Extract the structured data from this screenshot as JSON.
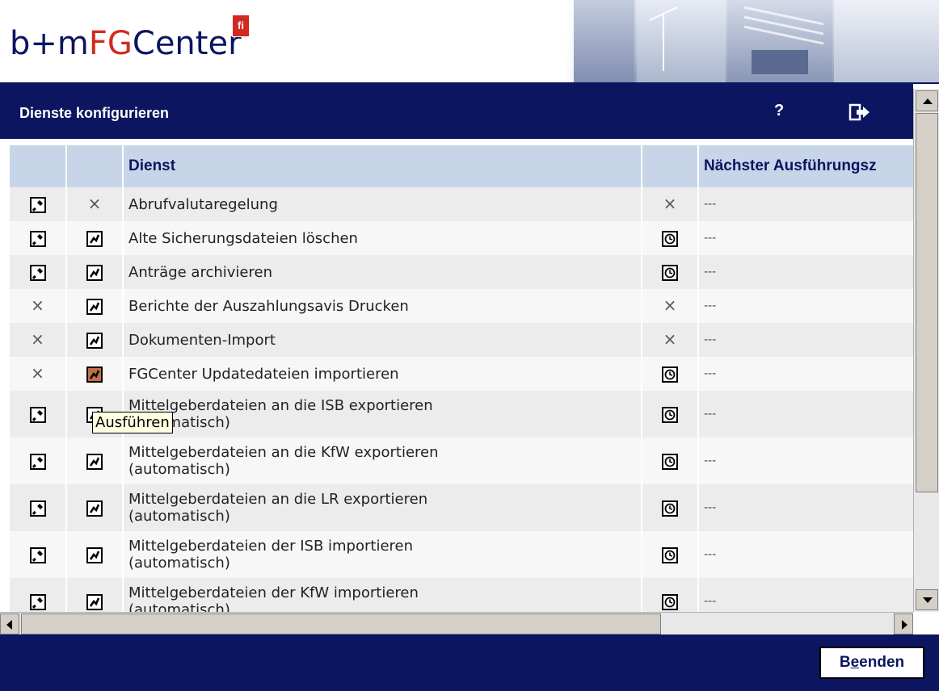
{
  "header": {
    "logo_bm": "b+m",
    "logo_fg": "FG",
    "logo_center": "Center",
    "logo_badge": "fi"
  },
  "titlebar": {
    "title": "Dienste konfigurieren",
    "help_label": "?"
  },
  "table": {
    "columns": [
      "",
      "",
      "Dienst",
      "",
      "Nächster Ausführungsz"
    ],
    "rows": [
      {
        "config": "tool",
        "run": "x",
        "name": [
          "Abrufvalutaregelung"
        ],
        "schedule": "x",
        "next": "---"
      },
      {
        "config": "tool",
        "run": "run",
        "name": [
          "Alte Sicherungsdateien löschen"
        ],
        "schedule": "clock",
        "next": "---"
      },
      {
        "config": "tool",
        "run": "run",
        "name": [
          "Anträge archivieren"
        ],
        "schedule": "clock",
        "next": "---"
      },
      {
        "config": "x",
        "run": "run",
        "name": [
          "Berichte der Auszahlungsavis Drucken"
        ],
        "schedule": "x",
        "next": "---"
      },
      {
        "config": "x",
        "run": "run",
        "name": [
          "Dokumenten-Import"
        ],
        "schedule": "x",
        "next": "---"
      },
      {
        "config": "x",
        "run": "run-active",
        "name": [
          "FGCenter Updatedateien importieren"
        ],
        "schedule": "clock",
        "next": "---"
      },
      {
        "config": "tool",
        "run": "run",
        "name": [
          "Mittelgeberdateien an die ISB exportieren",
          "(automatisch)"
        ],
        "schedule": "clock",
        "next": "---"
      },
      {
        "config": "tool",
        "run": "run",
        "name": [
          "Mittelgeberdateien an die KfW exportieren",
          "(automatisch)"
        ],
        "schedule": "clock",
        "next": "---"
      },
      {
        "config": "tool",
        "run": "run",
        "name": [
          "Mittelgeberdateien an die LR exportieren",
          "(automatisch)"
        ],
        "schedule": "clock",
        "next": "---"
      },
      {
        "config": "tool",
        "run": "run",
        "name": [
          "Mittelgeberdateien der ISB importieren",
          "(automatisch)"
        ],
        "schedule": "clock",
        "next": "---"
      },
      {
        "config": "tool",
        "run": "run",
        "name": [
          "Mittelgeberdateien der KfW importieren",
          "(automatisch)"
        ],
        "schedule": "clock",
        "next": "---"
      }
    ]
  },
  "tooltip": "Ausführen",
  "footer": {
    "end_label_pre": "B",
    "end_label_ul": "e",
    "end_label_post": "enden"
  },
  "colors": {
    "navy": "#0b1560",
    "brand_red": "#d22a1e",
    "header_row": "#c6d6e8",
    "active_icon": "#c0704a"
  },
  "icons": {
    "config": "tool-icon",
    "run": "run-icon",
    "schedule": "clock-icon",
    "unavailable": "x-icon",
    "help": "help-icon",
    "exit": "exit-icon"
  }
}
